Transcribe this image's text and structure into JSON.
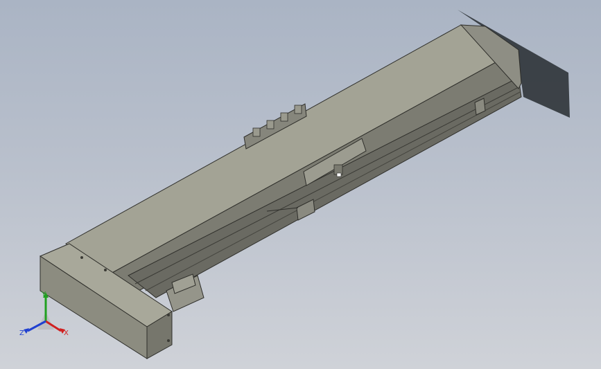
{
  "viewport": {
    "background_top": "#aab4c4",
    "background_bottom": "#cfd2d8",
    "model_color": "#8e8e84",
    "model_dark": "#5f5f58",
    "edge_color": "#2e2e2a"
  },
  "triad": {
    "x_label": "X",
    "y_label": "Y",
    "z_label": "Z",
    "x_color": "#d02020",
    "y_color": "#20a020",
    "z_color": "#2040d0"
  }
}
